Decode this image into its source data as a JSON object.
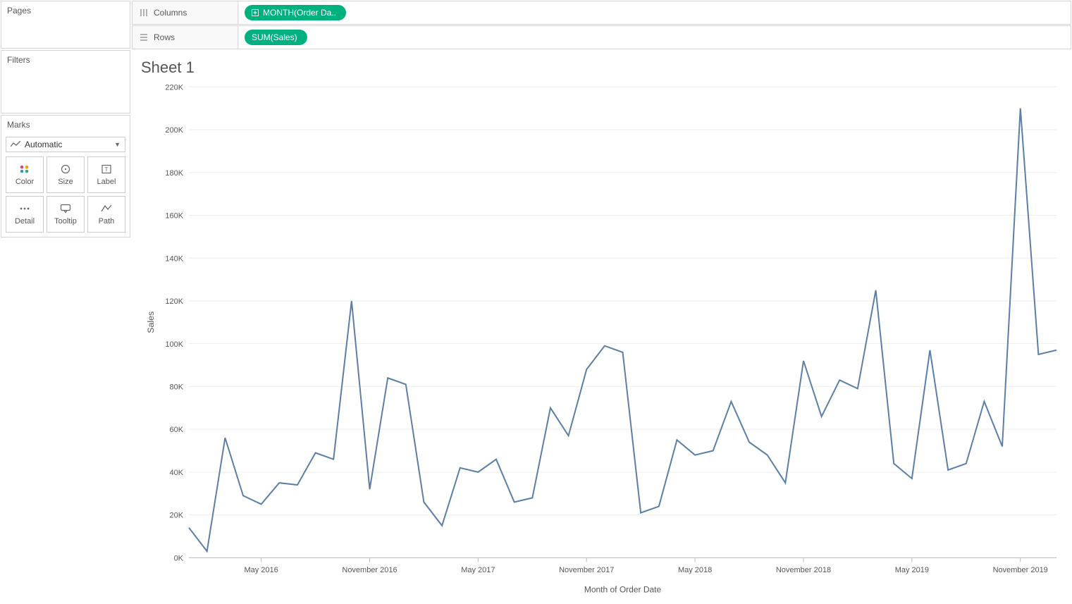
{
  "panels": {
    "pages": "Pages",
    "filters": "Filters",
    "marks": {
      "title": "Marks",
      "dropdown": "Automatic",
      "buttons": [
        "Color",
        "Size",
        "Label",
        "Detail",
        "Tooltip",
        "Path"
      ]
    }
  },
  "shelves": {
    "columns": {
      "label": "Columns",
      "pill": "MONTH(Order Da.."
    },
    "rows": {
      "label": "Rows",
      "pill": "SUM(Sales)"
    }
  },
  "sheet_title": "Sheet 1",
  "chart_data": {
    "type": "line",
    "title": "Sheet 1",
    "xlabel": "Month of Order Date",
    "ylabel": "Sales",
    "ylim": [
      0,
      220000
    ],
    "y_ticks": [
      0,
      20000,
      40000,
      60000,
      80000,
      100000,
      120000,
      140000,
      160000,
      180000,
      200000,
      220000
    ],
    "y_tick_labels": [
      "0K",
      "20K",
      "40K",
      "60K",
      "80K",
      "100K",
      "120K",
      "140K",
      "160K",
      "180K",
      "200K",
      "220K"
    ],
    "x_tick_indices": [
      4,
      10,
      16,
      22,
      28,
      34,
      40,
      46
    ],
    "x_tick_labels": [
      "May 2016",
      "November 2016",
      "May 2017",
      "November 2017",
      "May 2018",
      "November 2018",
      "May 2019",
      "November 2019"
    ],
    "series": [
      {
        "name": "SUM(Sales)",
        "x": [
          "Jan 2016",
          "Feb 2016",
          "Mar 2016",
          "Apr 2016",
          "May 2016",
          "Jun 2016",
          "Jul 2016",
          "Aug 2016",
          "Sep 2016",
          "Oct 2016",
          "Nov 2016",
          "Dec 2016",
          "Jan 2017",
          "Feb 2017",
          "Mar 2017",
          "Apr 2017",
          "May 2017",
          "Jun 2017",
          "Jul 2017",
          "Aug 2017",
          "Sep 2017",
          "Oct 2017",
          "Nov 2017",
          "Dec 2017",
          "Jan 2018",
          "Feb 2018",
          "Mar 2018",
          "Apr 2018",
          "May 2018",
          "Jun 2018",
          "Jul 2018",
          "Aug 2018",
          "Sep 2018",
          "Oct 2018",
          "Nov 2018",
          "Dec 2018",
          "Jan 2019",
          "Feb 2019",
          "Mar 2019",
          "Apr 2019",
          "May 2019",
          "Jun 2019",
          "Jul 2019",
          "Aug 2019",
          "Sep 2019",
          "Oct 2019",
          "Nov 2019",
          "Dec 2019"
        ],
        "values": [
          14000,
          3000,
          56000,
          29000,
          25000,
          35000,
          34000,
          49000,
          46000,
          120000,
          32000,
          84000,
          81000,
          26000,
          15000,
          42000,
          40000,
          46000,
          26000,
          28000,
          70000,
          57000,
          88000,
          99000,
          96000,
          21000,
          24000,
          55000,
          48000,
          50000,
          73000,
          54000,
          48000,
          35000,
          92000,
          66000,
          83000,
          79000,
          125000,
          44000,
          37000,
          97000,
          41000,
          44000,
          73000,
          52000,
          210000,
          95000
        ]
      }
    ],
    "last_point": 97000,
    "extra_x_after": 1,
    "line_color": "#5b7fa6"
  }
}
